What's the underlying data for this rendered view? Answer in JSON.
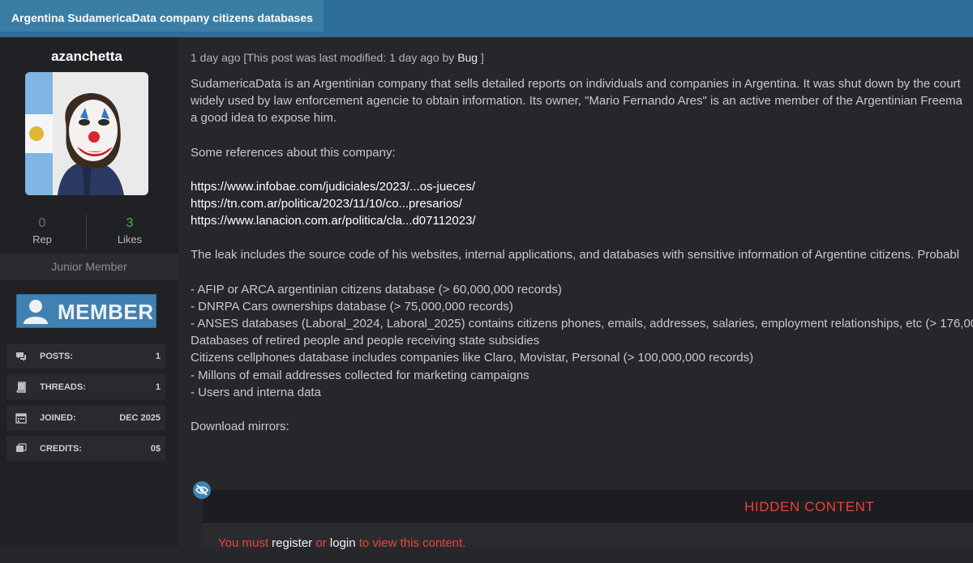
{
  "thread": {
    "title": "Argentina SudamericaData company citizens databases"
  },
  "user": {
    "name": "azanchetta",
    "rep_value": "0",
    "rep_label": "Rep",
    "likes_value": "3",
    "likes_label": "Likes",
    "rank": "Junior Member",
    "badge": "MEMBER",
    "stats": [
      {
        "icon": "posts-icon",
        "key": "POSTS:",
        "value": "1"
      },
      {
        "icon": "threads-icon",
        "key": "THREADS:",
        "value": "1"
      },
      {
        "icon": "calendar-icon",
        "key": "JOINED:",
        "value": "DEC 2025"
      },
      {
        "icon": "credits-icon",
        "key": "CREDITS:",
        "value": "0$"
      }
    ],
    "colors": {
      "likes": "#4caf50",
      "badge": "#3e82b3"
    }
  },
  "post": {
    "meta_prefix": "1 day ago [This post was last modified: 1 day ago by ",
    "modified_by": "Bug",
    "meta_suffix": " ]",
    "line1": "SudamericaData is an Argentinian company that sells detailed reports on individuals and companies in Argentina. It was shut down by the court",
    "line2": "widely used by law enforcement agencie to obtain information. Its owner, \"Mario Fernando Ares\" is an active member of the Argentinian Freema",
    "line3": "a good idea to expose him.",
    "refs_intro": "Some references about this company:",
    "links": [
      "https://www.infobae.com/judiciales/2023/...os-jueces/",
      "https://tn.com.ar/politica/2023/11/10/co...presarios/",
      "https://www.lanacion.com.ar/politica/cla...d07112023/"
    ],
    "leak_intro": "The leak includes the source code of his websites, internal applications, and databases with sensitive information of Argentine citizens. Probabl",
    "items": [
      "- AFIP or ARCA argentinian citizens database (> 60,000,000 records)",
      "- DNRPA Cars ownerships database (> 75,000,000 records)",
      "- ANSES databases (Laboral_2024, Laboral_2025) contains citizens phones, emails, addresses, salaries, employment relationships, etc (> 176,00",
      "Databases of retired people and people receiving state subsidies",
      "Citizens cellphones database includes companies like Claro, Movistar, Personal (> 100,000,000 records)",
      "- Millons of email addresses collected for marketing campaigns",
      "- Users and interna data"
    ],
    "download": "Download mirrors:"
  },
  "hidden": {
    "title": "HIDDEN CONTENT",
    "msg_a": "You must ",
    "register": "register",
    "msg_b": " or ",
    "login": "login",
    "msg_c": " to view this content.",
    "accent": "#e5443a"
  }
}
